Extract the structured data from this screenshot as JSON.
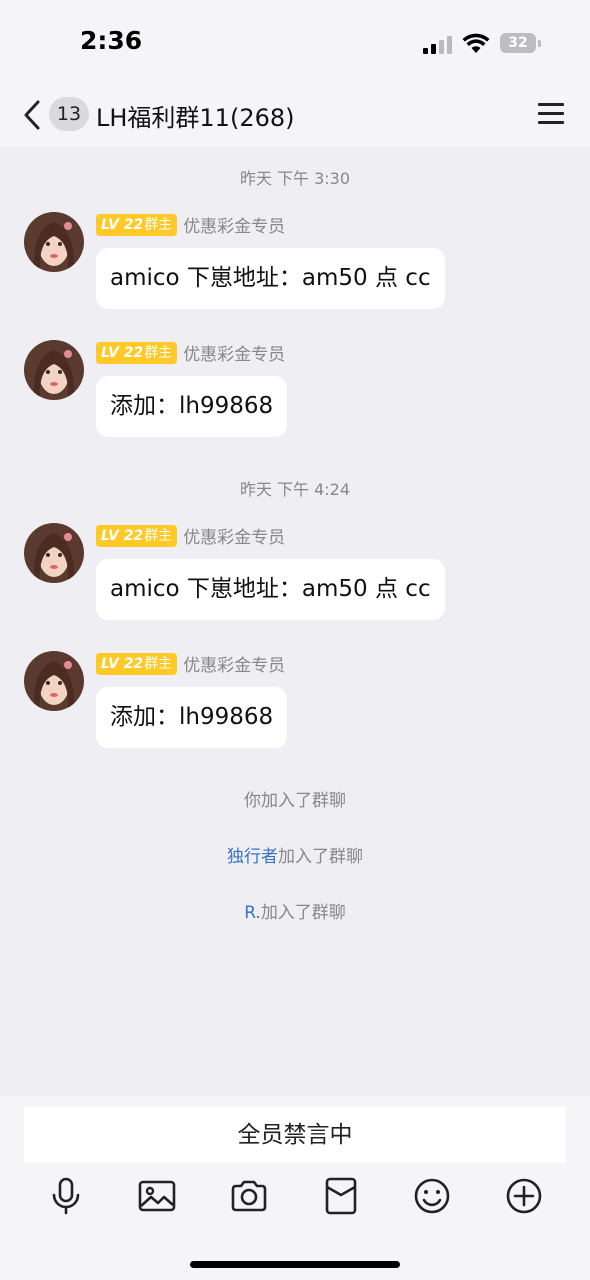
{
  "status_bar": {
    "time": "2:36",
    "battery": "32"
  },
  "header": {
    "back_count": "13",
    "title": "LH福利群11(268)"
  },
  "messages": [
    {
      "type": "time",
      "text": "昨天 下午 3:30"
    },
    {
      "type": "chat",
      "level": "LV 22",
      "role": "群主",
      "member_title": "优惠彩金专员",
      "text": "amico 下崽地址：am50 点 cc"
    },
    {
      "type": "chat",
      "level": "LV 22",
      "role": "群主",
      "member_title": "优惠彩金专员",
      "text": "添加：lh99868"
    },
    {
      "type": "time",
      "text": "昨天 下午 4:24"
    },
    {
      "type": "chat",
      "level": "LV 22",
      "role": "群主",
      "member_title": "优惠彩金专员",
      "text": "amico 下崽地址：am50 点 cc"
    },
    {
      "type": "chat",
      "level": "LV 22",
      "role": "群主",
      "member_title": "优惠彩金专员",
      "text": "添加：lh99868"
    }
  ],
  "system_messages": [
    {
      "name": "",
      "text": "你加入了群聊"
    },
    {
      "name": "独行者",
      "text": "加入了群聊"
    },
    {
      "name": "R.",
      "text": "加入了群聊"
    }
  ],
  "input": {
    "muted_text": "全员禁言中"
  },
  "toolbar": [
    "microphone-icon",
    "image-icon",
    "camera-icon",
    "red-envelope-icon",
    "emoji-icon",
    "plus-icon"
  ],
  "colors": {
    "level_badge": "#ffc928",
    "link": "#3a72c4",
    "background": "#eeeef3"
  }
}
